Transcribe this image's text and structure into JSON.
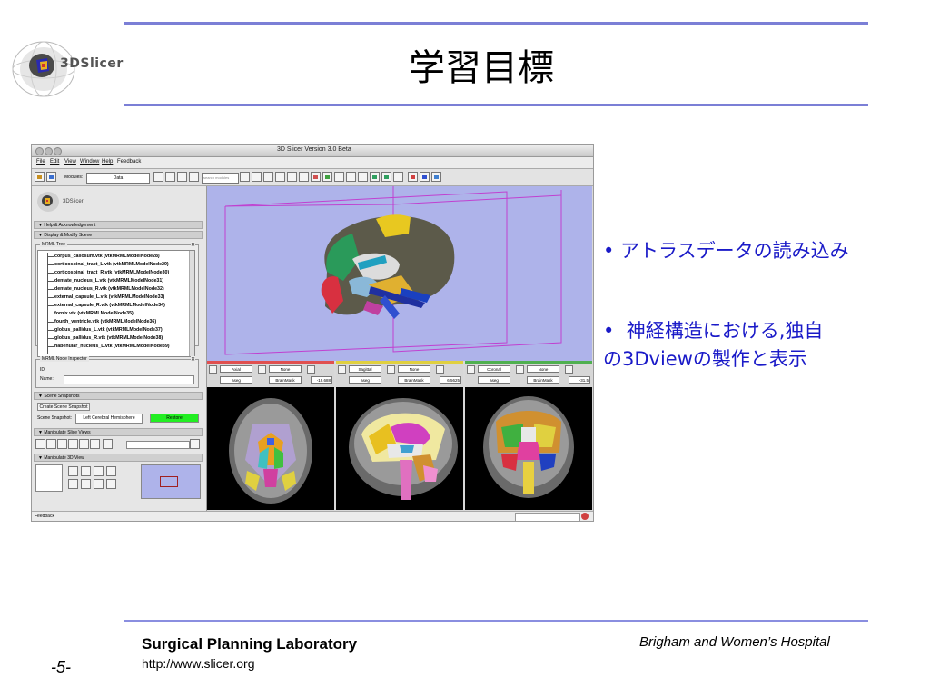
{
  "slide": {
    "title": "学習目標",
    "logo_text": "3DSlicer",
    "bullets": [
      "アトラスデータの読み込み",
      "神経構造における,独自",
      "の3Dviewの製作と表示"
    ],
    "footer": {
      "lab": "Surgical Planning Laboratory",
      "url": "http://www.slicer.org",
      "hospital": "Brigham and Women’s Hospital",
      "page": "-5-"
    },
    "accent_color": "#7b7fd6",
    "bullet_color": "#1a1ac8"
  },
  "app": {
    "window_title": "3D Slicer Version 3.0 Beta",
    "menus": [
      "File",
      "Edit",
      "View",
      "Window",
      "Help",
      "Feedback"
    ],
    "toolbar": {
      "modules_label": "Modules:",
      "modules_value": "Data",
      "search_placeholder": "search modules"
    },
    "panel": {
      "logo_text": "3DSlicer",
      "help_section": "Help & Acknowledgement",
      "display_section": "Display & Modify Scene",
      "mrml_tree_label": "MRML Tree",
      "tree_items": [
        "corpus_callosum.vtk (vtkMRMLModelNode28)",
        "corticospinal_tract_L.vtk (vtkMRMLModelNode29)",
        "corticospinal_tract_R.vtk (vtkMRMLModelNode30)",
        "dentate_nucleus_L.vtk (vtkMRMLModelNode31)",
        "dentate_nucleus_R.vtk (vtkMRMLModelNode32)",
        "external_capsule_L.vtk (vtkMRMLModelNode33)",
        "external_capsule_R.vtk (vtkMRMLModelNode34)",
        "fornix.vtk (vtkMRMLModelNode35)",
        "fourth_ventricle.vtk (vtkMRMLModelNode36)",
        "globus_pallidus_L.vtk (vtkMRMLModelNode37)",
        "globus_pallidus_R.vtk (vtkMRMLModelNode38)",
        "habenular_nucleus_L.vtk (vtkMRMLModelNode39)"
      ],
      "inspector_label": "MRML Node Inspector",
      "id_label": "ID:",
      "name_label": "Name:",
      "snapshots_section": "Scene Snapshots",
      "create_snapshot": "Create Scene Snapshot",
      "scene_snapshot_label": "Scene Snapshot:",
      "snapshot_value": "Left Cerebral Hemisphere",
      "restore": "Restore",
      "manip_slice_section": "Manipulate Slice Views",
      "manip_3d_section": "Manipulate 3D View"
    },
    "slices": [
      {
        "orientation": "Axial",
        "fg": "None",
        "bg": "None",
        "label": "aseg",
        "lut": "BrainMask",
        "offset": "-19.688",
        "color": "#e05050"
      },
      {
        "orientation": "Sagittal",
        "fg": "None",
        "bg": "None",
        "label": "aseg",
        "lut": "BrainMask",
        "offset": "6.5625",
        "color": "#e0d040"
      },
      {
        "orientation": "Coronal",
        "fg": "None",
        "bg": "None",
        "label": "aseg",
        "lut": "BrainMask",
        "offset": "-31.5",
        "color": "#50b050"
      }
    ],
    "status": "Feedback"
  }
}
